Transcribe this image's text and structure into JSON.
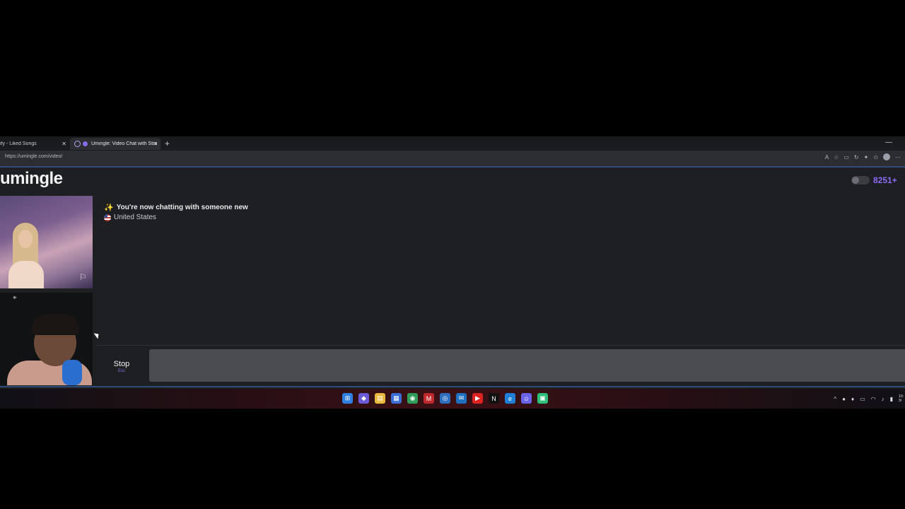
{
  "browser": {
    "tabs": [
      {
        "label": "ify - Liked Songs"
      },
      {
        "label": "Umingle: Video Chat with Stra"
      }
    ],
    "new_tab_icon": "plus-icon",
    "url": "https://umingle.com/video/"
  },
  "header": {
    "logo": "umingle",
    "online_count": "8251+"
  },
  "chat": {
    "status_message": "You're now chatting with someone new",
    "country": "United States"
  },
  "controls": {
    "stop_label": "Stop",
    "stop_hint": "Esc",
    "message_placeholder": ""
  },
  "colors": {
    "accent": "#8b6cf3",
    "background": "#1e1f22",
    "input_bg": "#4a4b4f"
  },
  "taskbar": {
    "icons": [
      "windows-start-icon",
      "copilot-icon",
      "file-explorer-icon",
      "store-icon",
      "chrome-icon",
      "mcafee-icon",
      "app-icon",
      "outlook-icon",
      "youtube-icon",
      "netflix-icon",
      "edge-icon",
      "discord-icon",
      "app-green-icon"
    ]
  }
}
